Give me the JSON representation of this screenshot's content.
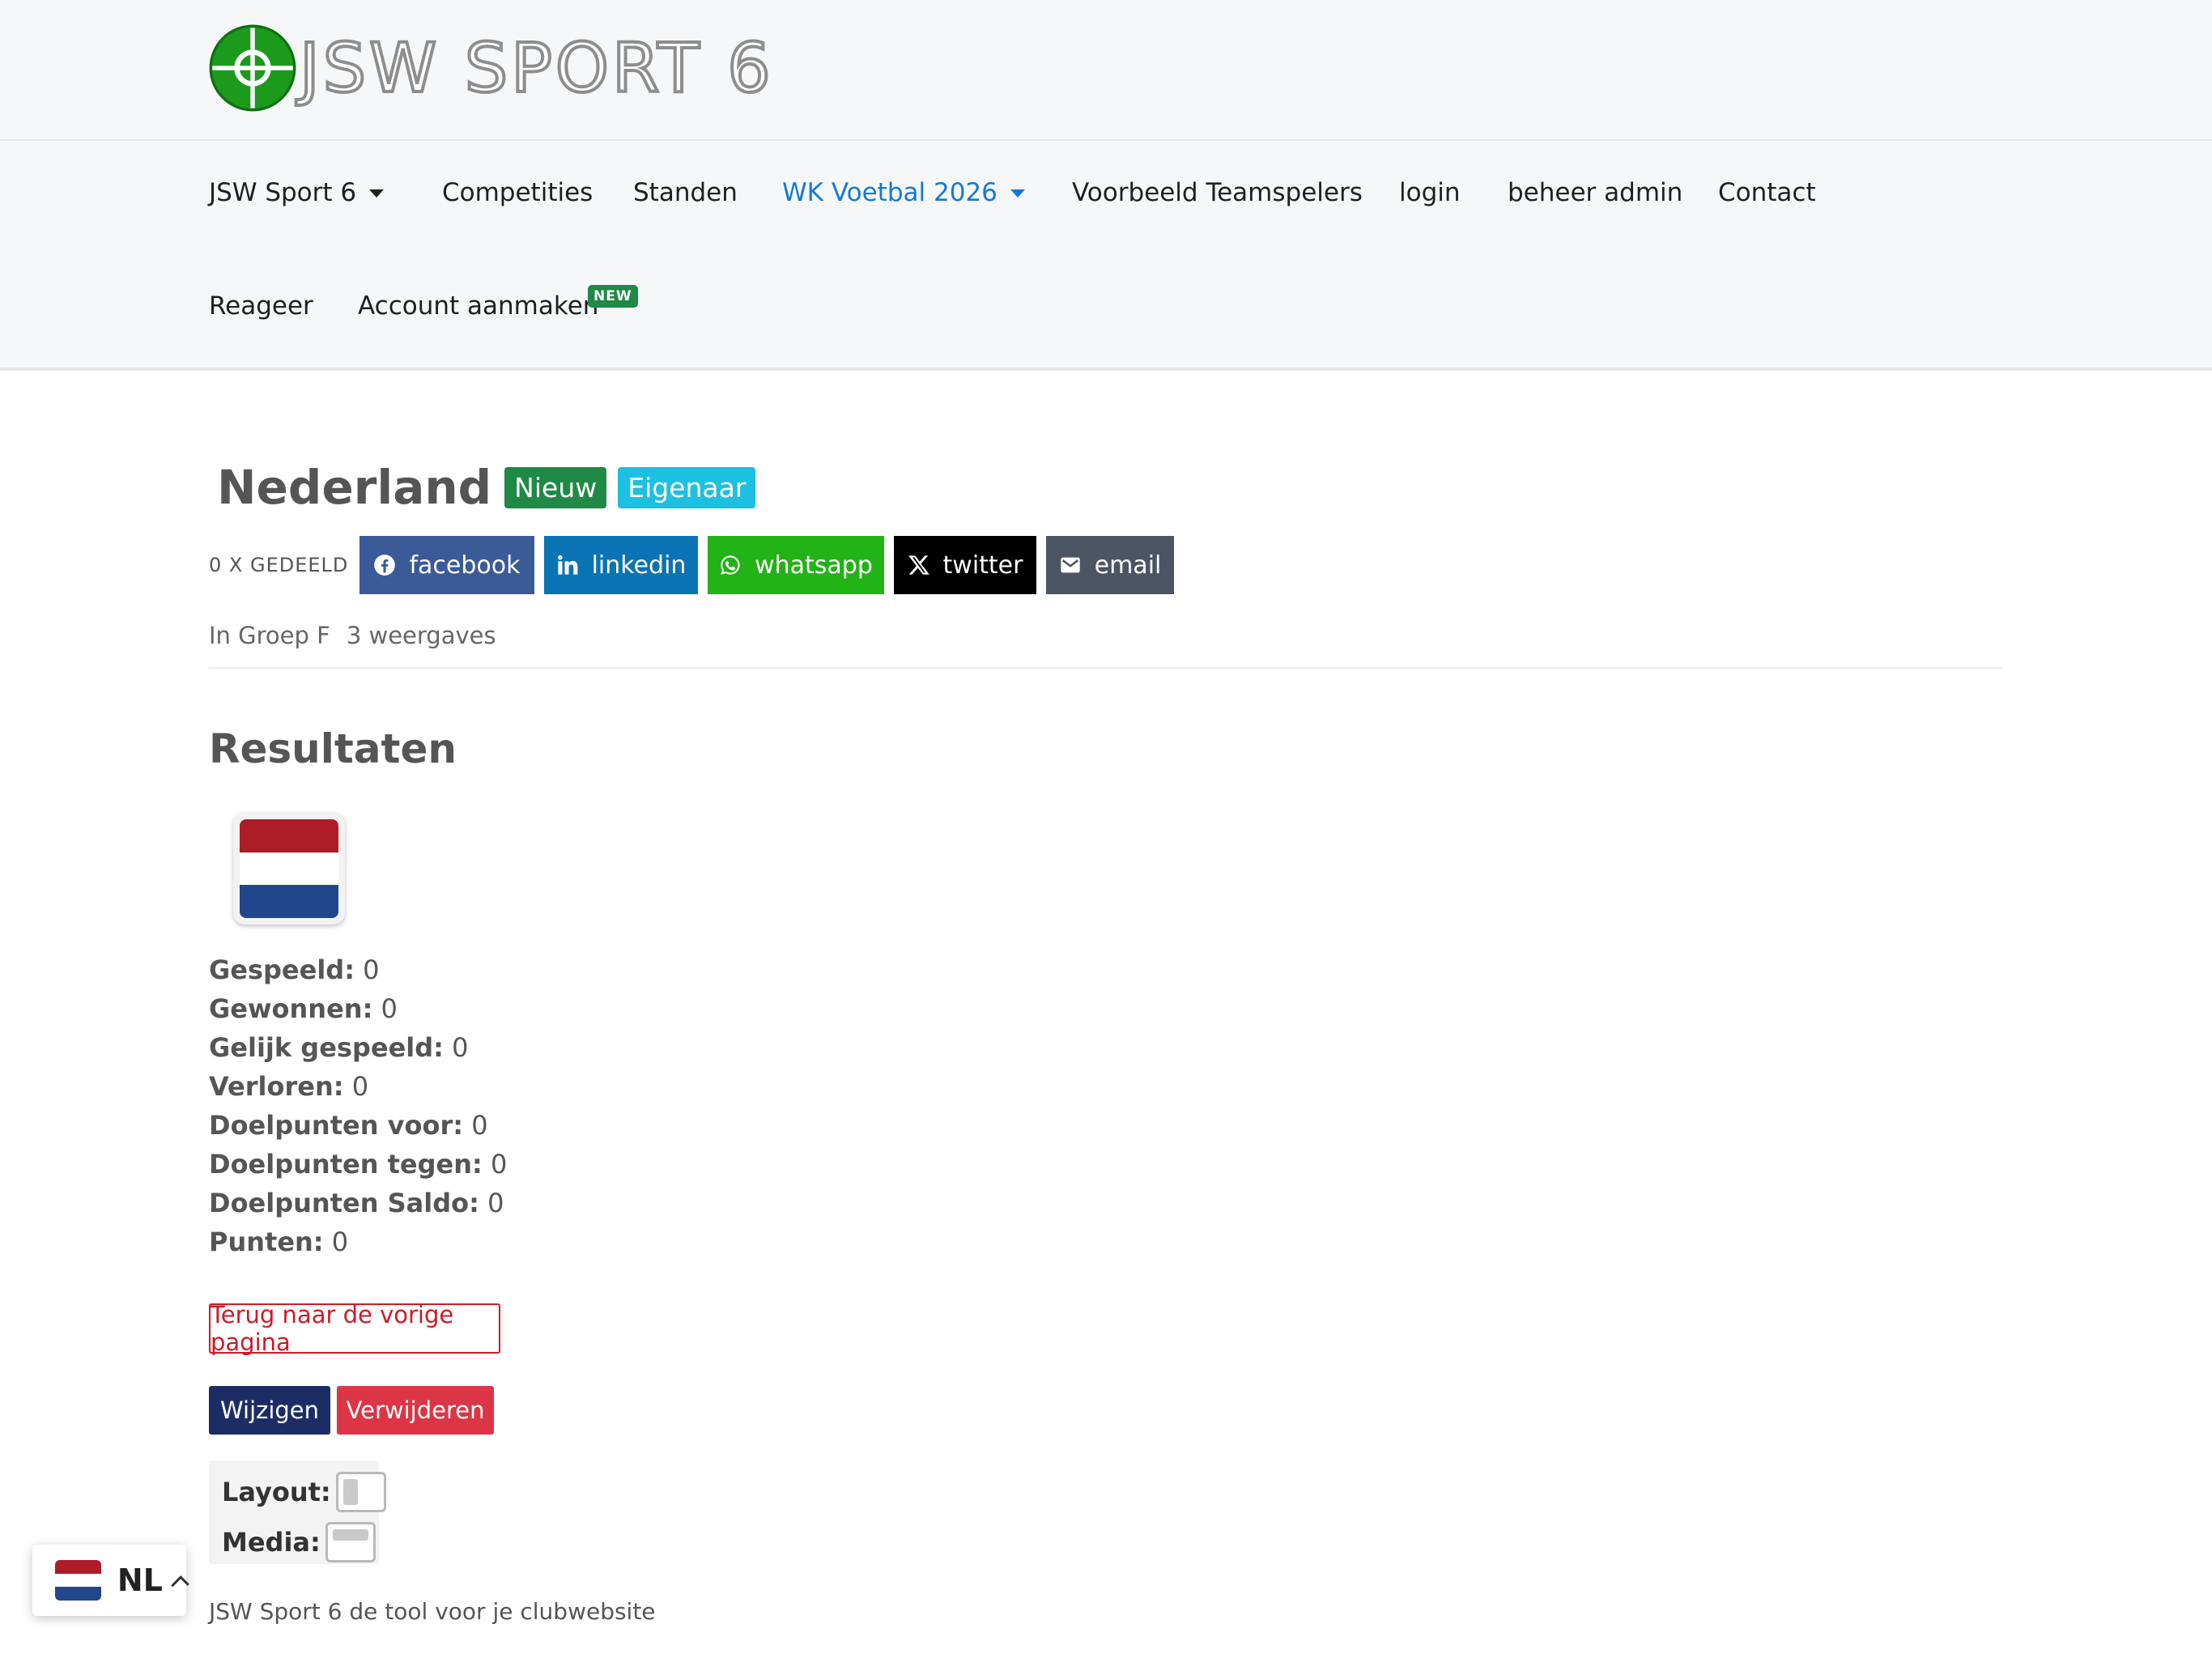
{
  "brand": {
    "name": "JSW SPORT 6"
  },
  "nav": {
    "items": [
      {
        "label": "JSW Sport 6",
        "dropdown": true
      },
      {
        "label": "Competities"
      },
      {
        "label": "Standen"
      },
      {
        "label": "WK Voetbal 2026",
        "dropdown": true,
        "active": true
      },
      {
        "label": "Voorbeeld Teamspelers"
      },
      {
        "label": "login"
      },
      {
        "label": "beheer admin"
      },
      {
        "label": "Contact"
      },
      {
        "label": "Reageer"
      },
      {
        "label": "Account aanmaken",
        "badge": "NEW"
      }
    ]
  },
  "team": {
    "name": "Nederland",
    "label_new": "Nieuw",
    "label_owner": "Eigenaar",
    "group": "In Groep F",
    "views": "3 weergaves",
    "flag_colors": [
      "#ae1c28",
      "#ffffff",
      "#21468b"
    ]
  },
  "share": {
    "count_label": "0 X GEDEELD",
    "facebook": "facebook",
    "linkedin": "linkedin",
    "whatsapp": "whatsapp",
    "twitter": "twitter",
    "email": "email"
  },
  "results": {
    "title": "Resultaten",
    "stats": [
      {
        "label": "Gespeeld:",
        "value": "0"
      },
      {
        "label": "Gewonnen:",
        "value": "0"
      },
      {
        "label": "Gelijk gespeeld:",
        "value": "0"
      },
      {
        "label": "Verloren:",
        "value": "0"
      },
      {
        "label": "Doelpunten voor:",
        "value": "0"
      },
      {
        "label": "Doelpunten tegen:",
        "value": "0"
      },
      {
        "label": "Doelpunten Saldo:",
        "value": "0"
      },
      {
        "label": "Punten:",
        "value": "0"
      }
    ]
  },
  "actions": {
    "back": "Terug naar de vorige pagina",
    "edit": "Wijzigen",
    "delete": "Verwijderen"
  },
  "options": {
    "layout_label": "Layout:",
    "media_label": "Media:"
  },
  "footer": {
    "text": "JSW Sport 6 de tool voor je clubwebsite"
  },
  "language": {
    "code": "NL"
  },
  "colors": {
    "accent": "#1479d6",
    "success": "#1e8a45",
    "info": "#1cc0e3",
    "danger": "#dc3545",
    "primary": "#1c2d66",
    "facebook": "#3b5a98",
    "linkedin": "#0a73b3",
    "whatsapp": "#22b316",
    "twitter": "#000000",
    "email": "#4b5563"
  }
}
